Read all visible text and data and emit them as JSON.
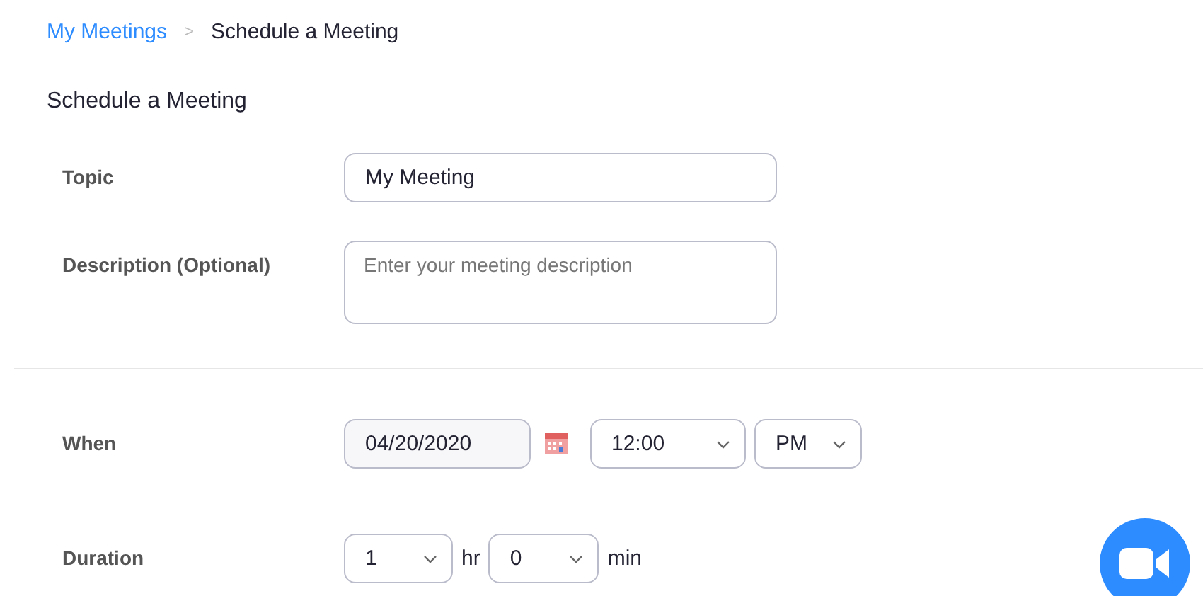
{
  "breadcrumb": {
    "link": "My Meetings",
    "separator": ">",
    "current": "Schedule a Meeting"
  },
  "heading": "Schedule a Meeting",
  "topic": {
    "label": "Topic",
    "value": "My Meeting"
  },
  "description": {
    "label": "Description (Optional)",
    "placeholder": "Enter your meeting description"
  },
  "when": {
    "label": "When",
    "date": "04/20/2020",
    "time": "12:00",
    "ampm": "PM"
  },
  "duration": {
    "label": "Duration",
    "hours": "1",
    "hours_unit": "hr",
    "minutes": "0",
    "minutes_unit": "min"
  }
}
